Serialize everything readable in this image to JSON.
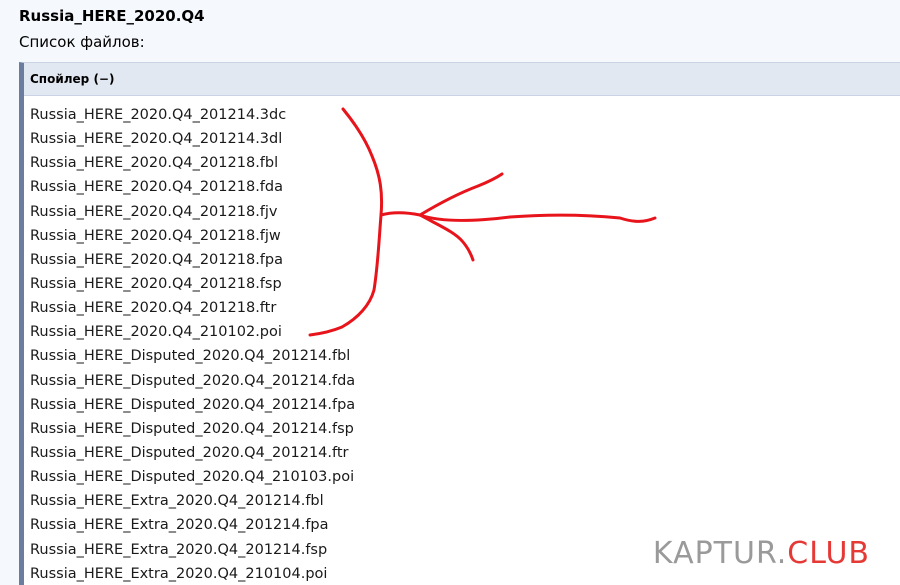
{
  "post": {
    "title": "Russia_HERE_2020.Q4",
    "file_list_label": "Список файлов:"
  },
  "spoiler": {
    "header": "Спойлер (−)",
    "files": [
      "Russia_HERE_2020.Q4_201214.3dc",
      "Russia_HERE_2020.Q4_201214.3dl",
      "Russia_HERE_2020.Q4_201218.fbl",
      "Russia_HERE_2020.Q4_201218.fda",
      "Russia_HERE_2020.Q4_201218.fjv",
      "Russia_HERE_2020.Q4_201218.fjw",
      "Russia_HERE_2020.Q4_201218.fpa",
      "Russia_HERE_2020.Q4_201218.fsp",
      "Russia_HERE_2020.Q4_201218.ftr",
      "Russia_HERE_2020.Q4_210102.poi",
      "Russia_HERE_Disputed_2020.Q4_201214.fbl",
      "Russia_HERE_Disputed_2020.Q4_201214.fda",
      "Russia_HERE_Disputed_2020.Q4_201214.fpa",
      "Russia_HERE_Disputed_2020.Q4_201214.fsp",
      "Russia_HERE_Disputed_2020.Q4_201214.ftr",
      "Russia_HERE_Disputed_2020.Q4_210103.poi",
      "Russia_HERE_Extra_2020.Q4_201214.fbl",
      "Russia_HERE_Extra_2020.Q4_201214.fpa",
      "Russia_HERE_Extra_2020.Q4_201214.fsp",
      "Russia_HERE_Extra_2020.Q4_210104.poi"
    ]
  },
  "watermark": {
    "part1": "KAPTUR.",
    "part2": "CLUB"
  },
  "colors": {
    "annotation": "#e8141b",
    "spoiler_border": "#6b7c9f",
    "spoiler_header_bg": "#e2e8f1",
    "watermark_gray": "#9a9a9a",
    "watermark_red": "#e53935"
  }
}
